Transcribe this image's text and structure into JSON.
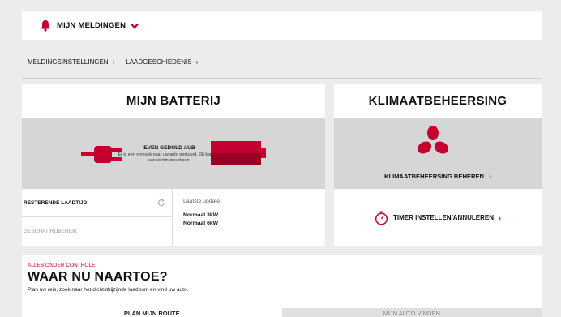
{
  "notifications": {
    "title": "MIJN MELDINGEN"
  },
  "breadcrumbs": [
    {
      "label": "MELDINGSINSTELLINGEN"
    },
    {
      "label": "LAADGESCHIEDENIS"
    }
  ],
  "battery": {
    "title": "MIJN BATTERIJ",
    "status_title": "EVEN GEDULD AUB",
    "status_text": "Er is een verzoek naar uw auto gestuurd. Dit kan een aantal minuten duren.",
    "remaining_label": "RESTERENDE LAADTIJD",
    "range_label": "GESCHAT RIJBEREIK",
    "last_update_label": "Laatste update:",
    "normal_3kw": "Normaal 3kW",
    "normal_6kw": "Normaal 6kW"
  },
  "climate": {
    "title": "KLIMAATBEHEERSING",
    "manage_label": "KLIMAATBEHEERSING BEHEREN",
    "timer_label": "TIMER INSTELLEN/ANNULEREN"
  },
  "route": {
    "kicker": "ALLES ONDER CONTROLE",
    "headline": "WAAR NU NAARTOE?",
    "subtext": "Plan uw reis, zoek naar het dichtstbijzijnde laadpunt en vind uw auto.",
    "tabs": [
      {
        "label": "PLAN MIJN ROUTE"
      },
      {
        "label": "MIJN AUTO VINDEN"
      }
    ]
  },
  "colors": {
    "accent": "#c3002f",
    "panel_gray": "#d6d6d6",
    "page_bg": "#ececec"
  }
}
